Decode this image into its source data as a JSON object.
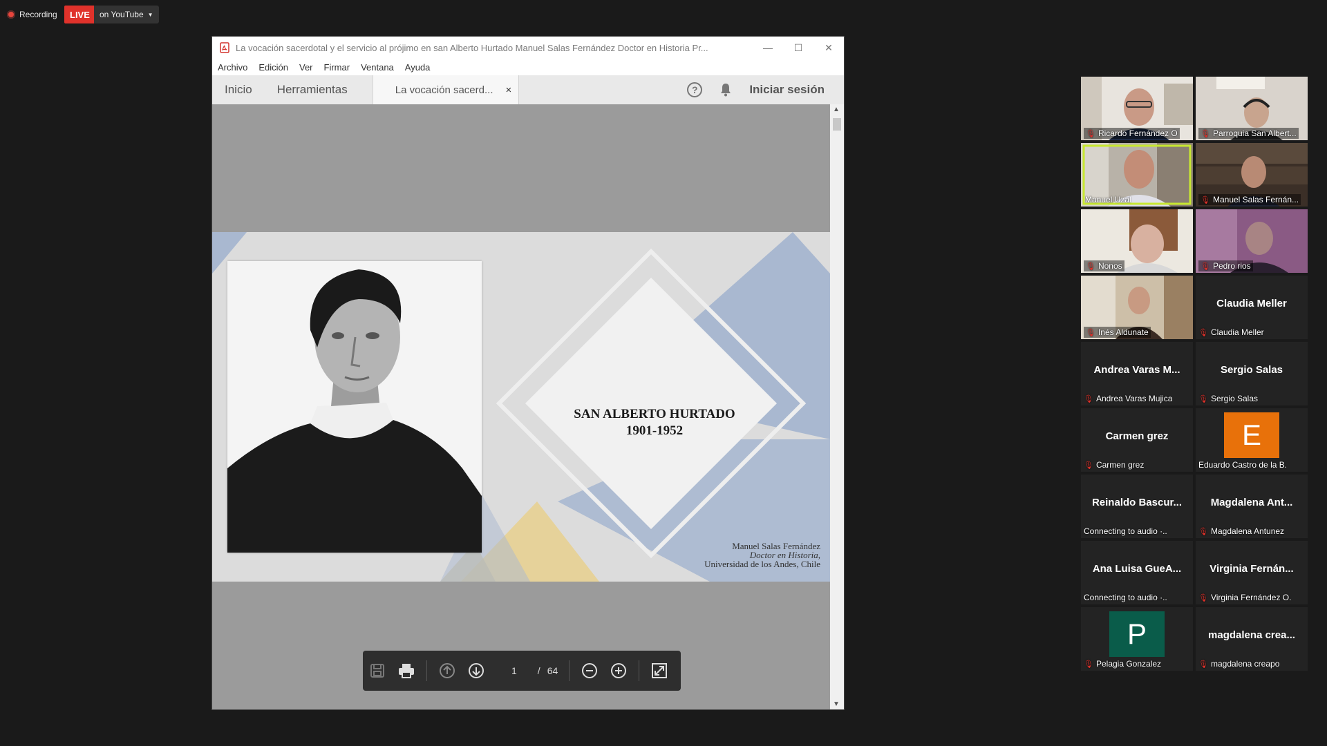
{
  "recording": {
    "label": "Recording",
    "live": "LIVE",
    "destination": "on YouTube"
  },
  "window": {
    "title": "La vocación sacerdotal y el servicio al prójimo en san Alberto Hurtado  Manuel Salas Fernández Doctor en Historia Pr...",
    "menu": [
      "Archivo",
      "Edición",
      "Ver",
      "Firmar",
      "Ventana",
      "Ayuda"
    ],
    "toolbar": {
      "home": "Inicio",
      "tools": "Herramientas",
      "tab": "La vocación sacerd...",
      "tab_close": "×",
      "signin": "Iniciar sesión",
      "help": "?"
    },
    "slide": {
      "title_line1": "SAN ALBERTO HURTADO",
      "title_line2": "1901-1952",
      "author_line1": "Manuel Salas Fernández",
      "author_line2": "Doctor en Historia,",
      "author_line3": "Universidad de los Andes, Chile"
    },
    "page_nav": {
      "current": "1",
      "separator": "/",
      "total": "64"
    }
  },
  "colors": {
    "live": "#e0322b",
    "active_speaker": "#c8e830",
    "slide_blue": "#a9b8d0",
    "slide_yellow": "#e6d29a"
  },
  "participants": [
    {
      "name": "Ricardo Fernández O",
      "muted": true,
      "video": true
    },
    {
      "name": "Parroquia San Albert...",
      "muted": true,
      "video": true
    },
    {
      "name": "Manuel Uzal",
      "muted": false,
      "video": true,
      "active": true
    },
    {
      "name": "Manuel Salas Fernán...",
      "muted": true,
      "video": true
    },
    {
      "name": "Nonos",
      "muted": true,
      "video": true
    },
    {
      "name": "Pedro rios",
      "muted": true,
      "video": true
    },
    {
      "name": "Inés Aldunate",
      "muted": true,
      "video": true
    },
    {
      "name": "Claudia  Meller",
      "display": "Claudia  Meller",
      "muted": true
    },
    {
      "name": "Andrea Varas Mujica",
      "display": "Andrea Varas M...",
      "muted": true
    },
    {
      "name": "Sergio Salas",
      "display": "Sergio Salas",
      "muted": true
    },
    {
      "name": "Carmen grez",
      "display": "Carmen grez",
      "muted": true
    },
    {
      "name": "Eduardo Castro de la B.",
      "avatar": "E",
      "avatar_color": "#e8710a",
      "muted": false
    },
    {
      "name": "Connecting to audio ·..",
      "display": "Reinaldo  Bascur...",
      "muted": false
    },
    {
      "name": "Magdalena Antunez",
      "display": "Magdalena  Ant...",
      "muted": true
    },
    {
      "name": "Connecting to audio ·..",
      "display": "Ana Luisa GueA...",
      "muted": false
    },
    {
      "name": "Virginia Fernández O.",
      "display": "Virginia  Fernán...",
      "muted": true
    },
    {
      "name": "Pelagia Gonzalez",
      "avatar": "P",
      "avatar_color": "#0a5c4a",
      "muted": true
    },
    {
      "name": "magdalena creapo",
      "display": "magdalena  crea...",
      "muted": true
    }
  ]
}
